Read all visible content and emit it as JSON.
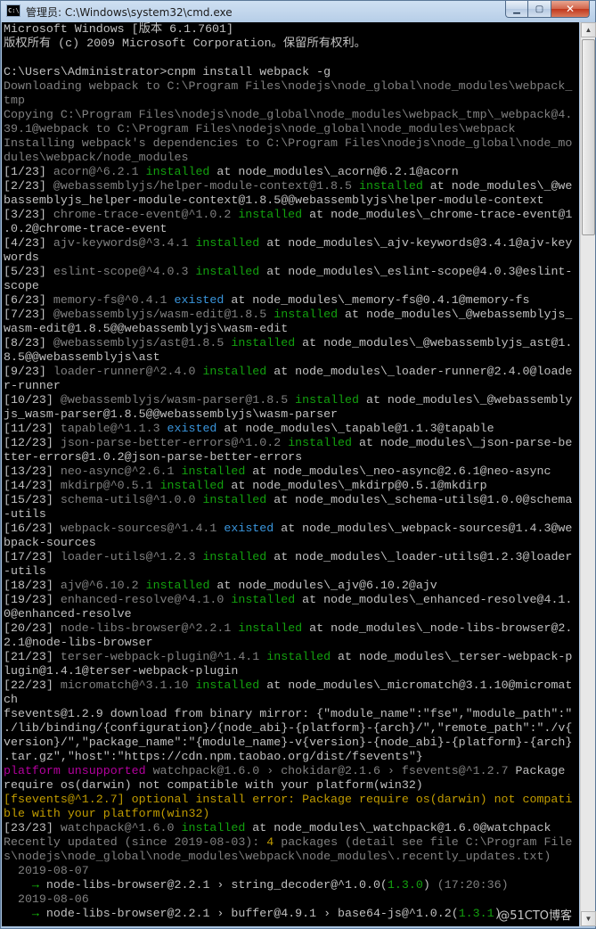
{
  "window": {
    "icon_text": "C:\\",
    "title": "管理员: C:\\Windows\\system32\\cmd.exe",
    "min_icon": "minimize-icon",
    "max_icon": "maximize-icon",
    "close_icon": "close-icon"
  },
  "watermark": "@51CTO博客",
  "lines": [
    [
      [
        "w",
        "Microsoft Windows [版本 6.1.7601]"
      ]
    ],
    [
      [
        "w",
        "版权所有 (c) 2009 Microsoft Corporation。保留所有权利。"
      ]
    ],
    [
      [
        "w",
        ""
      ]
    ],
    [
      [
        "w",
        "C:\\Users\\Administrator>cnpm install webpack -g"
      ]
    ],
    [
      [
        "g",
        "Downloading webpack to C:\\Program Files\\nodejs\\node_global\\node_modules\\webpack_"
      ]
    ],
    [
      [
        "g",
        "tmp"
      ]
    ],
    [
      [
        "g",
        "Copying C:\\Program Files\\nodejs\\node_global\\node_modules\\webpack_tmp\\_webpack@4."
      ]
    ],
    [
      [
        "g",
        "39.1@webpack to C:\\Program Files\\nodejs\\node_global\\node_modules\\webpack"
      ]
    ],
    [
      [
        "g",
        "Installing webpack's dependencies to C:\\Program Files\\nodejs\\node_global\\node_mo"
      ]
    ],
    [
      [
        "g",
        "dules\\webpack/node_modules"
      ]
    ],
    [
      [
        "w",
        "[1/23] "
      ],
      [
        "g",
        "acorn@^6.2.1 "
      ],
      [
        "gr",
        "installed"
      ],
      [
        "w",
        " at node_modules\\_acorn@6.2.1@acorn"
      ]
    ],
    [
      [
        "w",
        "[2/23] "
      ],
      [
        "g",
        "@webassemblyjs/helper-module-context@1.8.5 "
      ],
      [
        "gr",
        "installed"
      ],
      [
        "w",
        " at node_modules\\_@we"
      ]
    ],
    [
      [
        "w",
        "bassemblyjs_helper-module-context@1.8.5@@webassemblyjs\\helper-module-context"
      ]
    ],
    [
      [
        "w",
        "[3/23] "
      ],
      [
        "g",
        "chrome-trace-event@^1.0.2 "
      ],
      [
        "gr",
        "installed"
      ],
      [
        "w",
        " at node_modules\\_chrome-trace-event@1"
      ]
    ],
    [
      [
        "w",
        ".0.2@chrome-trace-event"
      ]
    ],
    [
      [
        "w",
        "[4/23] "
      ],
      [
        "g",
        "ajv-keywords@^3.4.1 "
      ],
      [
        "gr",
        "installed"
      ],
      [
        "w",
        " at node_modules\\_ajv-keywords@3.4.1@ajv-key"
      ]
    ],
    [
      [
        "w",
        "words"
      ]
    ],
    [
      [
        "w",
        "[5/23] "
      ],
      [
        "g",
        "eslint-scope@^4.0.3 "
      ],
      [
        "gr",
        "installed"
      ],
      [
        "w",
        " at node_modules\\_eslint-scope@4.0.3@eslint-"
      ]
    ],
    [
      [
        "w",
        "scope"
      ]
    ],
    [
      [
        "w",
        "[6/23] "
      ],
      [
        "g",
        "memory-fs@^0.4.1 "
      ],
      [
        "cy",
        "existed"
      ],
      [
        "w",
        " at node_modules\\_memory-fs@0.4.1@memory-fs"
      ]
    ],
    [
      [
        "w",
        "[7/23] "
      ],
      [
        "g",
        "@webassemblyjs/wasm-edit@1.8.5 "
      ],
      [
        "gr",
        "installed"
      ],
      [
        "w",
        " at node_modules\\_@webassemblyjs_"
      ]
    ],
    [
      [
        "w",
        "wasm-edit@1.8.5@@webassemblyjs\\wasm-edit"
      ]
    ],
    [
      [
        "w",
        "[8/23] "
      ],
      [
        "g",
        "@webassemblyjs/ast@1.8.5 "
      ],
      [
        "gr",
        "installed"
      ],
      [
        "w",
        " at node_modules\\_@webassemblyjs_ast@1."
      ]
    ],
    [
      [
        "w",
        "8.5@@webassemblyjs\\ast"
      ]
    ],
    [
      [
        "w",
        "[9/23] "
      ],
      [
        "g",
        "loader-runner@^2.4.0 "
      ],
      [
        "gr",
        "installed"
      ],
      [
        "w",
        " at node_modules\\_loader-runner@2.4.0@loade"
      ]
    ],
    [
      [
        "w",
        "r-runner"
      ]
    ],
    [
      [
        "w",
        "[10/23] "
      ],
      [
        "g",
        "@webassemblyjs/wasm-parser@1.8.5 "
      ],
      [
        "gr",
        "installed"
      ],
      [
        "w",
        " at node_modules\\_@webassembly"
      ]
    ],
    [
      [
        "w",
        "js_wasm-parser@1.8.5@@webassemblyjs\\wasm-parser"
      ]
    ],
    [
      [
        "w",
        "[11/23] "
      ],
      [
        "g",
        "tapable@^1.1.3 "
      ],
      [
        "cy",
        "existed"
      ],
      [
        "w",
        " at node_modules\\_tapable@1.1.3@tapable"
      ]
    ],
    [
      [
        "w",
        "[12/23] "
      ],
      [
        "g",
        "json-parse-better-errors@^1.0.2 "
      ],
      [
        "gr",
        "installed"
      ],
      [
        "w",
        " at node_modules\\_json-parse-be"
      ]
    ],
    [
      [
        "w",
        "tter-errors@1.0.2@json-parse-better-errors"
      ]
    ],
    [
      [
        "w",
        "[13/23] "
      ],
      [
        "g",
        "neo-async@^2.6.1 "
      ],
      [
        "gr",
        "installed"
      ],
      [
        "w",
        " at node_modules\\_neo-async@2.6.1@neo-async"
      ]
    ],
    [
      [
        "w",
        "[14/23] "
      ],
      [
        "g",
        "mkdirp@^0.5.1 "
      ],
      [
        "gr",
        "installed"
      ],
      [
        "w",
        " at node_modules\\_mkdirp@0.5.1@mkdirp"
      ]
    ],
    [
      [
        "w",
        "[15/23] "
      ],
      [
        "g",
        "schema-utils@^1.0.0 "
      ],
      [
        "gr",
        "installed"
      ],
      [
        "w",
        " at node_modules\\_schema-utils@1.0.0@schema"
      ]
    ],
    [
      [
        "w",
        "-utils"
      ]
    ],
    [
      [
        "w",
        "[16/23] "
      ],
      [
        "g",
        "webpack-sources@^1.4.1 "
      ],
      [
        "cy",
        "existed"
      ],
      [
        "w",
        " at node_modules\\_webpack-sources@1.4.3@we"
      ]
    ],
    [
      [
        "w",
        "bpack-sources"
      ]
    ],
    [
      [
        "w",
        "[17/23] "
      ],
      [
        "g",
        "loader-utils@^1.2.3 "
      ],
      [
        "gr",
        "installed"
      ],
      [
        "w",
        " at node_modules\\_loader-utils@1.2.3@loader"
      ]
    ],
    [
      [
        "w",
        "-utils"
      ]
    ],
    [
      [
        "w",
        "[18/23] "
      ],
      [
        "g",
        "ajv@^6.10.2 "
      ],
      [
        "gr",
        "installed"
      ],
      [
        "w",
        " at node_modules\\_ajv@6.10.2@ajv"
      ]
    ],
    [
      [
        "w",
        "[19/23] "
      ],
      [
        "g",
        "enhanced-resolve@^4.1.0 "
      ],
      [
        "gr",
        "installed"
      ],
      [
        "w",
        " at node_modules\\_enhanced-resolve@4.1."
      ]
    ],
    [
      [
        "w",
        "0@enhanced-resolve"
      ]
    ],
    [
      [
        "w",
        "[20/23] "
      ],
      [
        "g",
        "node-libs-browser@^2.2.1 "
      ],
      [
        "gr",
        "installed"
      ],
      [
        "w",
        " at node_modules\\_node-libs-browser@2."
      ]
    ],
    [
      [
        "w",
        "2.1@node-libs-browser"
      ]
    ],
    [
      [
        "w",
        "[21/23] "
      ],
      [
        "g",
        "terser-webpack-plugin@^1.4.1 "
      ],
      [
        "gr",
        "installed"
      ],
      [
        "w",
        " at node_modules\\_terser-webpack-p"
      ]
    ],
    [
      [
        "w",
        "lugin@1.4.1@terser-webpack-plugin"
      ]
    ],
    [
      [
        "w",
        "[22/23] "
      ],
      [
        "g",
        "micromatch@^3.1.10 "
      ],
      [
        "gr",
        "installed"
      ],
      [
        "w",
        " at node_modules\\_micromatch@3.1.10@micromat"
      ]
    ],
    [
      [
        "w",
        "ch"
      ]
    ],
    [
      [
        "w",
        "fsevents@1.2.9 download from binary mirror: {\"module_name\":\"fse\",\"module_path\":\""
      ]
    ],
    [
      [
        "w",
        "./lib/binding/{configuration}/{node_abi}-{platform}-{arch}/\",\"remote_path\":\"./v{"
      ]
    ],
    [
      [
        "w",
        "version}/\",\"package_name\":\"{module_name}-v{version}-{node_abi}-{platform}-{arch}"
      ]
    ],
    [
      [
        "w",
        ".tar.gz\",\"host\":\"https://cdn.npm.taobao.org/dist/fsevents\"}"
      ]
    ],
    [
      [
        "mg",
        "platform unsupported "
      ],
      [
        "g",
        "watchpack@1.6.0 › chokidar@2.1.6 › fsevents@^1.2.7 "
      ],
      [
        "w",
        "Package"
      ]
    ],
    [
      [
        "w",
        "require os(darwin) not compatible with your platform(win32)"
      ]
    ],
    [
      [
        "ye",
        "[fsevents@^1.2.7] optional install error: Package require os(darwin) not compati"
      ]
    ],
    [
      [
        "ye",
        "ble with your platform(win32)"
      ]
    ],
    [
      [
        "w",
        "[23/23] "
      ],
      [
        "g",
        "watchpack@^1.6.0 "
      ],
      [
        "gr",
        "installed"
      ],
      [
        "w",
        " at node_modules\\_watchpack@1.6.0@watchpack"
      ]
    ],
    [
      [
        "g",
        "Recently updated (since 2019-08-03): "
      ],
      [
        "ye",
        "4"
      ],
      [
        "g",
        " packages (detail see file C:\\Program File"
      ]
    ],
    [
      [
        "g",
        "s\\nodejs\\node_global\\node_modules\\webpack\\node_modules\\.recently_updates.txt)"
      ]
    ],
    [
      [
        "g",
        "  2019-08-07"
      ]
    ],
    [
      [
        "gb",
        "    → "
      ],
      [
        "w",
        "node-libs-browser@2.2.1 › string_decoder@^1.0.0("
      ],
      [
        "gr",
        "1.3.0"
      ],
      [
        "w",
        ") "
      ],
      [
        "g",
        "(17:20:36)"
      ]
    ],
    [
      [
        "g",
        "  2019-08-06"
      ]
    ],
    [
      [
        "gb",
        "    → "
      ],
      [
        "w",
        "node-libs-browser@2.2.1 › buffer@4.9.1 › base64-js@^1.0.2("
      ],
      [
        "gr",
        "1.3.1"
      ],
      [
        "w",
        ")"
      ]
    ]
  ]
}
